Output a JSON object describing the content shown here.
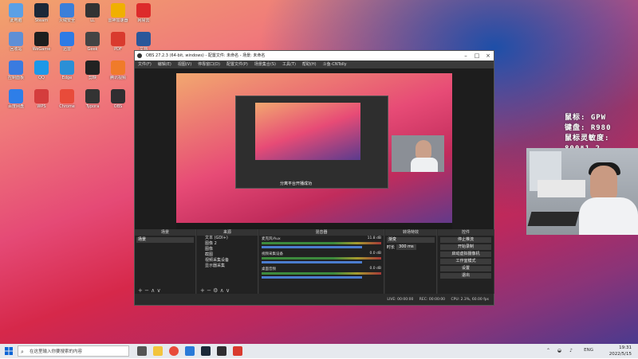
{
  "desktop_icons": [
    {
      "label": "此电脑",
      "color": "#5aa0e6"
    },
    {
      "label": "Steam",
      "color": "#1b2838"
    },
    {
      "label": "火绒安全",
      "color": "#3b7fd9"
    },
    {
      "label": "LL",
      "color": "#333"
    },
    {
      "label": "雷神加速器",
      "color": "#f0b000"
    },
    {
      "label": "网易云",
      "color": "#dd2b2b"
    },
    {
      "label": "回收站",
      "color": "#5e8fd6"
    },
    {
      "label": "WeGame",
      "color": "#1e1e1e"
    },
    {
      "label": "迅雷",
      "color": "#2d7be5"
    },
    {
      "label": "Geek",
      "color": "#444"
    },
    {
      "label": "PDF",
      "color": "#d93a2e"
    },
    {
      "label": "文档",
      "color": "#2b579a"
    },
    {
      "label": "控制面板",
      "color": "#3a7be0"
    },
    {
      "label": "QQ",
      "color": "#1d98e8"
    },
    {
      "label": "Edge",
      "color": "#2b8fd6"
    },
    {
      "label": "剪映",
      "color": "#222"
    },
    {
      "label": "腾讯视频",
      "color": "#f07b2a"
    },
    {
      "label": "计划表",
      "color": "#217346"
    },
    {
      "label": "百度网盘",
      "color": "#2e7ee8"
    },
    {
      "label": "WPS",
      "color": "#d43d3d"
    },
    {
      "label": "Chrome",
      "color": "#e84b3a"
    },
    {
      "label": "Typora",
      "color": "#333"
    },
    {
      "label": "OBS",
      "color": "#302e31"
    },
    {
      "label": "报告",
      "color": "#2b579a"
    }
  ],
  "obs": {
    "title": "OBS 27.2.3 (64-bit, windows) - 配置文件: 未命名 - 场景: 未命名",
    "menu": [
      "文件(F)",
      "编辑(E)",
      "视图(V)",
      "停靠窗口(D)",
      "配置文件(P)",
      "场景集合(S)",
      "工具(T)",
      "帮助(H)",
      "斗鱼-CNTolly"
    ],
    "preview_caption": "分离平台开播成功",
    "docks": {
      "scenes": {
        "header": "场景",
        "items": [
          "场景"
        ]
      },
      "sources": {
        "header": "来源",
        "items": [
          "文本 (GDI+)",
          "图像 2",
          "图像",
          "截图",
          "视频采集设备",
          "显示器采集"
        ]
      },
      "mixer": {
        "header": "混音器",
        "channels": [
          {
            "name": "麦克风/Aux",
            "db": "11.8 dB"
          },
          {
            "name": "视频采集设备",
            "db": "0.0 dB"
          },
          {
            "name": "桌面音频",
            "db": "0.0 dB"
          }
        ]
      },
      "transitions": {
        "header": "转场特效",
        "type": "渐变",
        "duration_label": "时长",
        "duration": "300 ms"
      },
      "controls": {
        "header": "控件",
        "buttons": [
          "停止推流",
          "开始录制",
          "启动虚拟摄像机",
          "工作室模式",
          "设置",
          "退出"
        ]
      }
    },
    "status": {
      "live": "LIVE: 00:00:00",
      "rec": "REC: 00:00:00",
      "cpu": "CPU: 2.3%, 60.00 fps"
    }
  },
  "hud": {
    "line1": "鼠标: GPW",
    "line2": "键盘: R980",
    "line3": "鼠标灵敏度: 800*1.2"
  },
  "taskbar": {
    "search_placeholder": "在这里输入你要搜索的内容",
    "ime": "ENG",
    "time": "19:31",
    "date": "2022/5/15"
  }
}
